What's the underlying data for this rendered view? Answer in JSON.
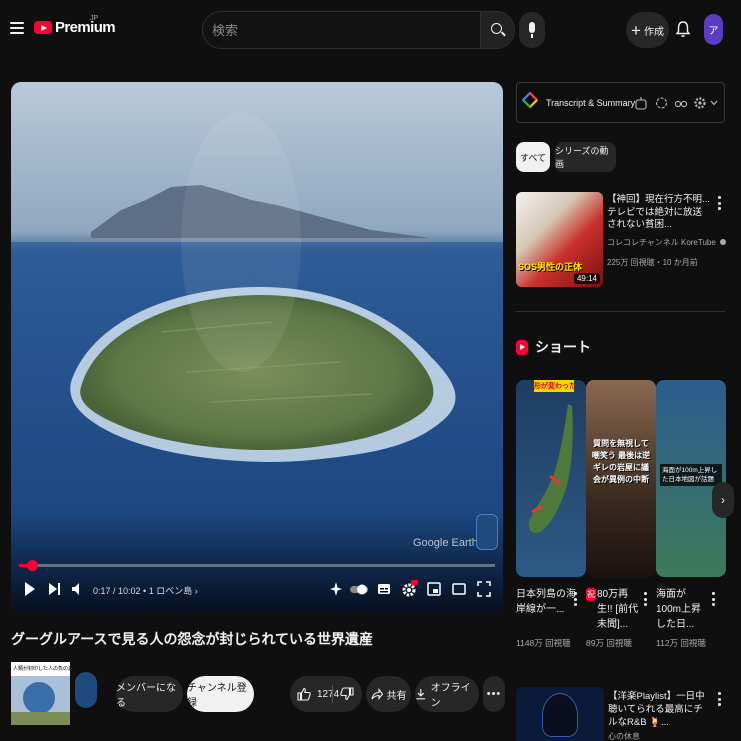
{
  "header": {
    "logo_text": "Premium",
    "logo_region": "JP",
    "search_placeholder": "検索",
    "create_label": "作成",
    "avatar_initial": "ア"
  },
  "player": {
    "watermark": "Google Earth",
    "progress_fraction": 0.028,
    "time_text": "0:17 / 10:02 • 1 ロベン島 ›"
  },
  "video": {
    "title": "グーグルアースで見る人の怨念が封じられている世界遺産",
    "channel_thumb_caption": "人類が封印した人の負の遺産",
    "member_label": "メンバーになる",
    "subscribe_label": "チャンネル登録",
    "like_count": "1274",
    "share_label": "共有",
    "offline_label": "オフライン"
  },
  "sidebar": {
    "extension_title": "Transcript & Summary",
    "chips": [
      "すべて",
      "シリーズの動画"
    ],
    "related": {
      "title": "【神回】現在行方不明...テレビでは絶対に放送されない貧困...",
      "channel": "コレコレチャンネル KoreTube",
      "meta": "225万 回視聴・10 か月前",
      "duration": "49:14",
      "thumb_caption": "SOS男性の正体"
    },
    "shorts_heading": "ショート",
    "shorts": [
      {
        "title": "日本列島の海岸線が一...",
        "views": "1148万 回視聴",
        "overlay": "形が変わった"
      },
      {
        "title": "80万再生!! [前代未聞]...",
        "views": "89万 回視聴",
        "overlay": "質問を無視して嘲笑う 最後は逆ギレの岩屋に議会が異例の中断",
        "badge": "祝"
      },
      {
        "title": "海面が100m上昇した日...",
        "views": "112万 回視聴",
        "overlay": "海面が100m上昇した日本地図が話題"
      }
    ],
    "playlist": {
      "title": "【洋楽Playlist】一日中聴いてられる最高にチルなR&B 🍹...",
      "channel": "心の休息"
    }
  },
  "colors": {
    "accent": "#ff0033",
    "background": "#0f0f0f",
    "chip_bg": "#272727"
  }
}
